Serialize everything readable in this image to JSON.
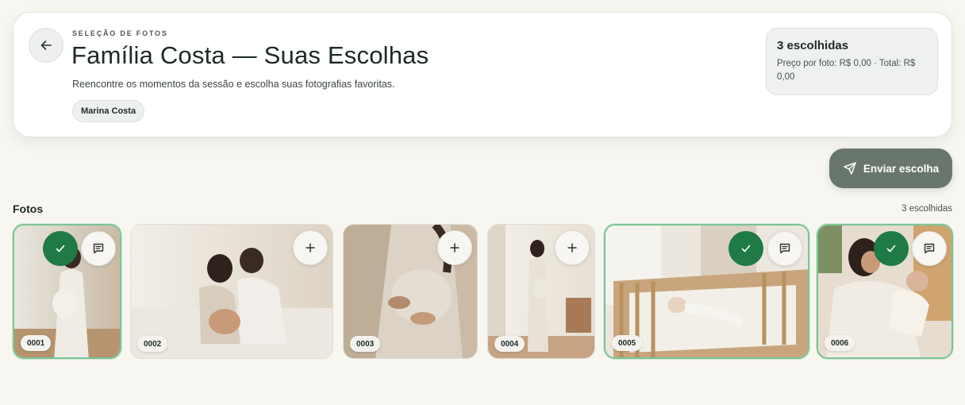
{
  "header": {
    "eyebrow": "SELEÇÃO DE FOTOS",
    "title": "Família Costa — Suas Escolhas",
    "subtitle": "Reencontre os momentos da sessão e escolha suas fotografias favoritas.",
    "client_name": "Marina Costa",
    "back_icon": "arrow-left-icon"
  },
  "summary": {
    "count_label": "3 escolhidas",
    "price_line": "Preço por foto: R$ 0,00 · Total: R$ 0,00"
  },
  "actions": {
    "send_label": "Enviar escolha",
    "send_icon": "send-icon"
  },
  "gallery": {
    "section_title": "Fotos",
    "selected_count": "3 escolhidas",
    "photos": [
      {
        "number": "0001",
        "selected": true,
        "scene": "pregnant woman in white dress by window"
      },
      {
        "number": "0002",
        "selected": false,
        "scene": "couple sitting on bed, foreheads touching"
      },
      {
        "number": "0003",
        "selected": false,
        "scene": "close-up of hands on pregnant belly"
      },
      {
        "number": "0004",
        "selected": false,
        "scene": "pregnant woman standing in bright room"
      },
      {
        "number": "0005",
        "selected": true,
        "scene": "newborn sleeping in wooden crib"
      },
      {
        "number": "0006",
        "selected": true,
        "scene": "mother holding newborn baby"
      }
    ]
  },
  "colors": {
    "background": "#f8f6f1",
    "accent_green": "#1f7a45",
    "send_button": "#69766d",
    "selected_border": "#7cc495"
  },
  "icons": {
    "check": "check-icon",
    "comment": "comment-icon",
    "add": "plus-icon"
  }
}
